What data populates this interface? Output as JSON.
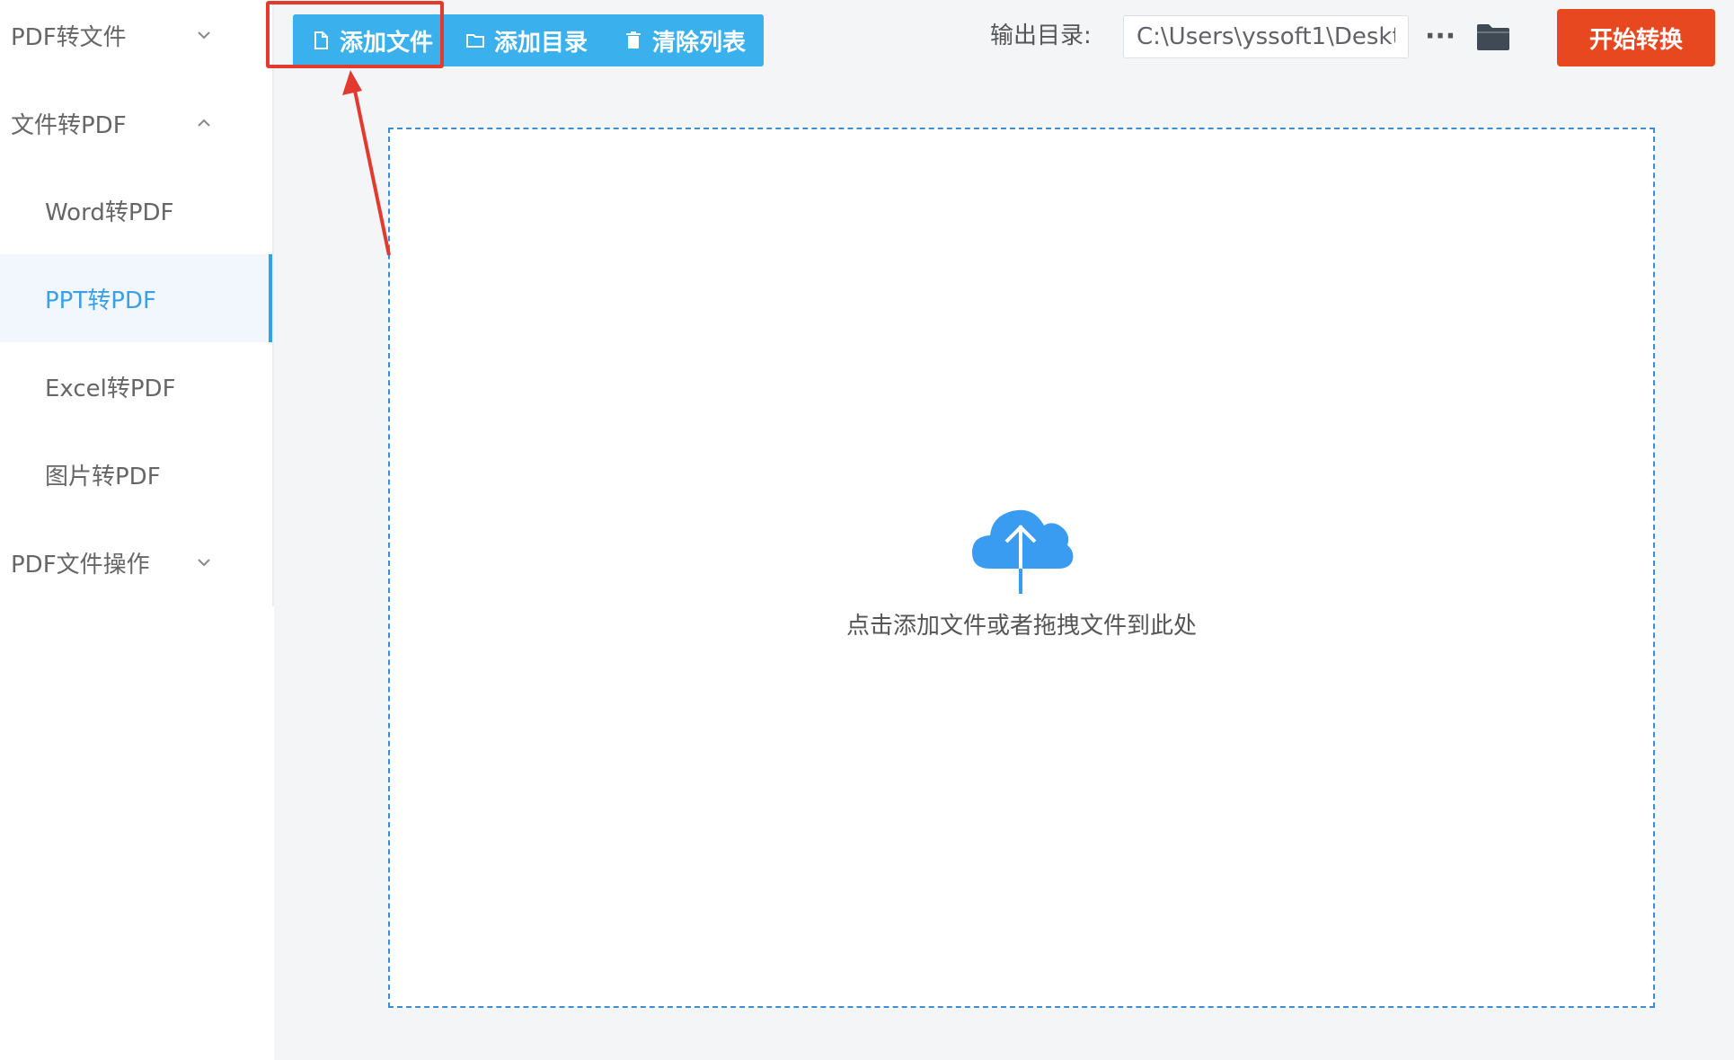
{
  "sidebar": {
    "items": [
      {
        "label": "PDF转文件",
        "kind": "group",
        "expanded": false
      },
      {
        "label": "文件转PDF",
        "kind": "group",
        "expanded": true
      },
      {
        "label": "Word转PDF",
        "kind": "sub"
      },
      {
        "label": "PPT转PDF",
        "kind": "sub",
        "active": true
      },
      {
        "label": "Excel转PDF",
        "kind": "sub"
      },
      {
        "label": "图片转PDF",
        "kind": "sub"
      },
      {
        "label": "PDF文件操作",
        "kind": "group",
        "expanded": false
      }
    ]
  },
  "toolbar": {
    "add_file_label": "添加文件",
    "add_dir_label": "添加目录",
    "clear_list_label": "清除列表",
    "output_label": "输出目录:",
    "output_path": "C:\\Users\\yssoft1\\Deskt",
    "more_label": "···",
    "start_label": "开始转换"
  },
  "dropzone": {
    "hint": "点击添加文件或者拖拽文件到此处"
  },
  "icons": {
    "add_file": "file-icon",
    "add_dir": "folder-outline-icon",
    "clear_list": "trash-icon",
    "browse": "folder-icon",
    "upload": "cloud-upload-icon",
    "chevron_down": "chevron-down-icon",
    "chevron_up": "chevron-up-icon"
  },
  "colors": {
    "accent_blue": "#3ab0ec",
    "active_nav": "#3aa0e6",
    "start_button": "#e8481f",
    "highlight": "#e33a2f",
    "upload_cloud": "#3a9cf0"
  }
}
